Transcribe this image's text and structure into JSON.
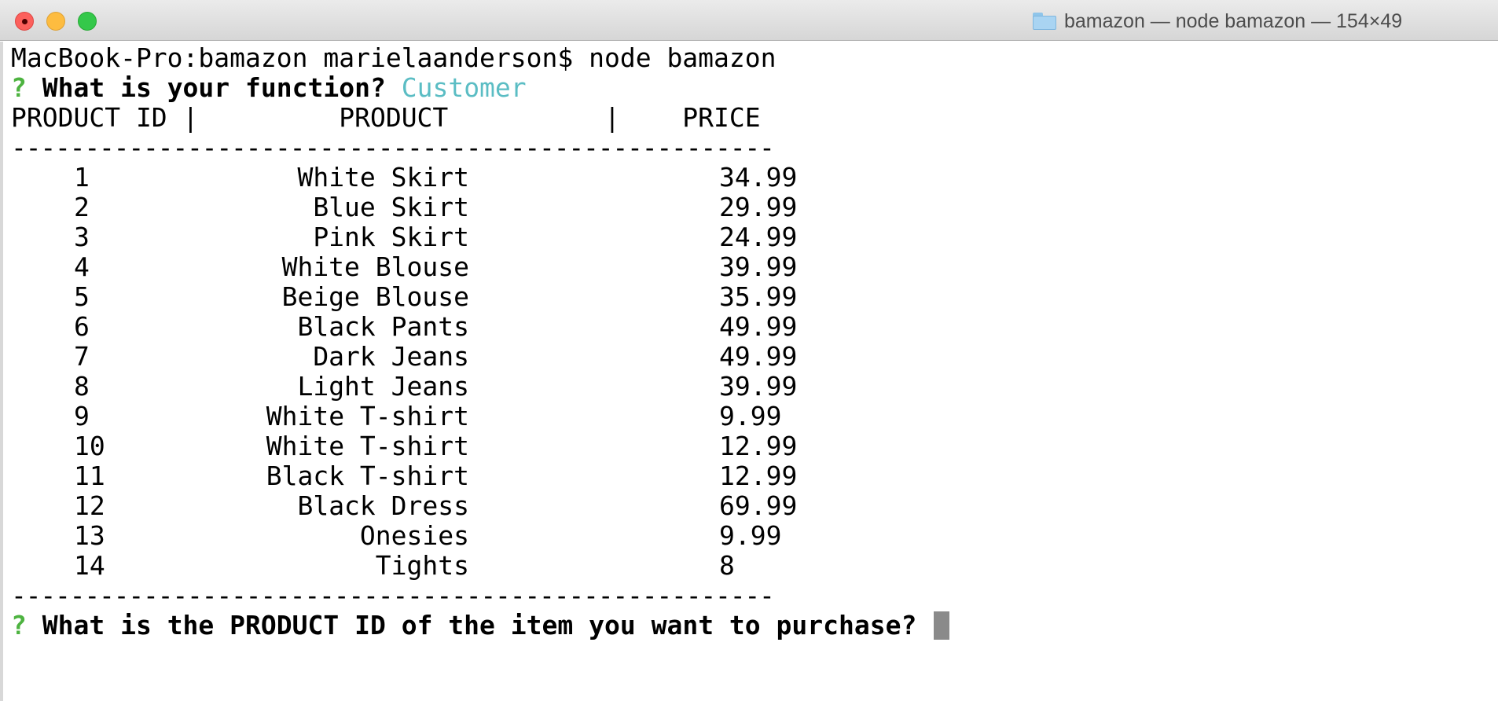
{
  "window": {
    "title": "bamazon — node bamazon — 154×49",
    "folder_icon": "folder-icon"
  },
  "terminal": {
    "command_line": "MacBook-Pro:bamazon marielaanderson$ node bamazon",
    "prompt1": {
      "marker": "?",
      "question": "What is your function?",
      "answer": "Customer"
    },
    "table": {
      "header": "PRODUCT ID |         PRODUCT          |    PRICE",
      "separator": "----------------------------------------------------",
      "rows": [
        {
          "id": "1",
          "product": "White Skirt",
          "price": "34.99"
        },
        {
          "id": "2",
          "product": "Blue Skirt",
          "price": "29.99"
        },
        {
          "id": "3",
          "product": "Pink Skirt",
          "price": "24.99"
        },
        {
          "id": "4",
          "product": "White Blouse",
          "price": "39.99"
        },
        {
          "id": "5",
          "product": "Beige Blouse",
          "price": "35.99"
        },
        {
          "id": "6",
          "product": "Black Pants",
          "price": "49.99"
        },
        {
          "id": "7",
          "product": "Dark Jeans",
          "price": "49.99"
        },
        {
          "id": "8",
          "product": "Light Jeans",
          "price": "39.99"
        },
        {
          "id": "9",
          "product": "White T-shirt",
          "price": "9.99"
        },
        {
          "id": "10",
          "product": "White T-shirt",
          "price": "12.99"
        },
        {
          "id": "11",
          "product": "Black T-shirt",
          "price": "12.99"
        },
        {
          "id": "12",
          "product": "Black Dress",
          "price": "69.99"
        },
        {
          "id": "13",
          "product": "Onesies",
          "price": "9.99"
        },
        {
          "id": "14",
          "product": "Tights",
          "price": "8"
        }
      ]
    },
    "prompt2": {
      "marker": "?",
      "question": "What is the PRODUCT ID of the item you want to purchase?"
    }
  },
  "colors": {
    "prompt_marker": "#4db340",
    "answer": "#5bbdc4",
    "cursor": "#8a8a8a"
  }
}
